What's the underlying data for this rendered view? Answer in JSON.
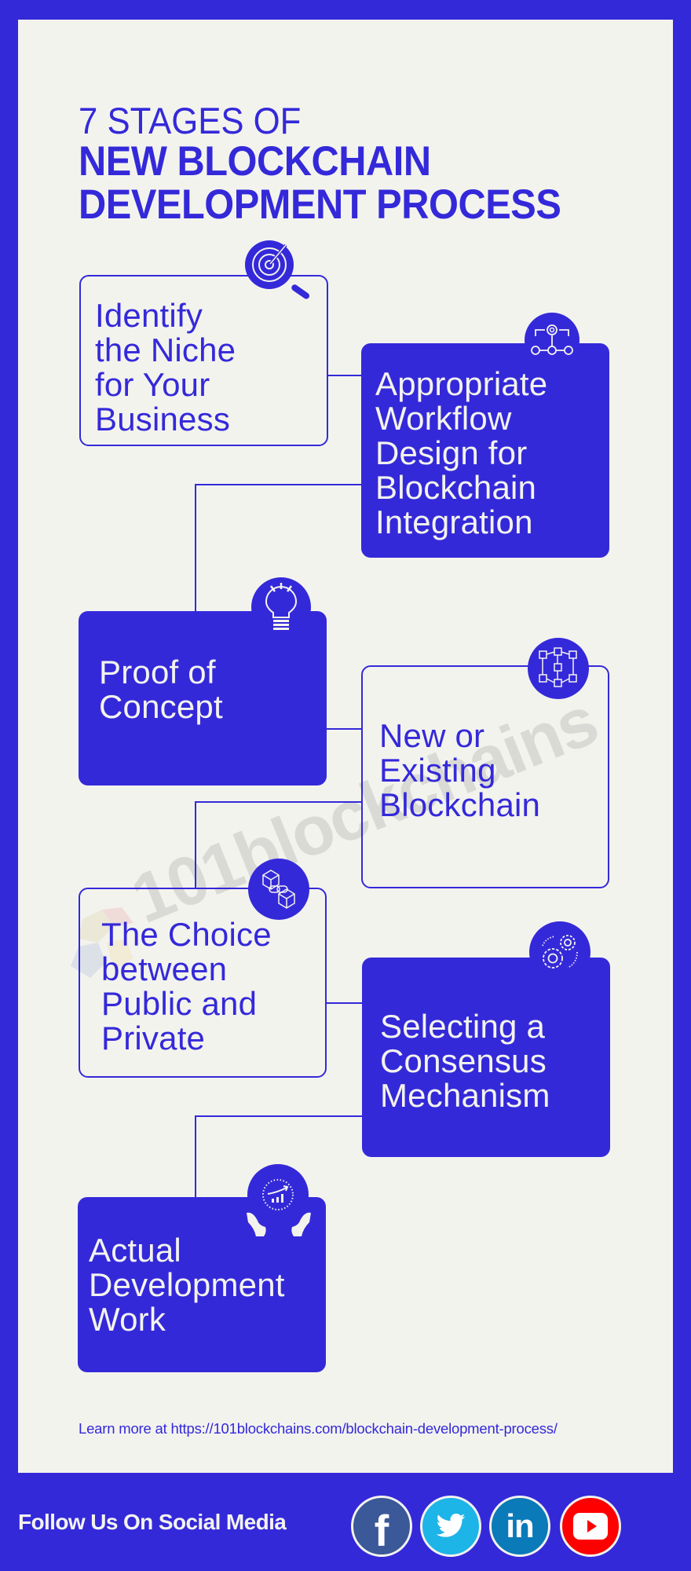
{
  "header": {
    "line1": "7 STAGES OF",
    "line2": "NEW BLOCKCHAIN",
    "line3": "DEVELOPMENT PROCESS"
  },
  "stages": [
    {
      "label": "Identify\nthe Niche\nfor Your\nBusiness",
      "icon": "target-search-icon",
      "style": "outline"
    },
    {
      "label": "Appropriate\nWorkflow\nDesign for\nBlockchain\nIntegration",
      "icon": "workflow-gear-icon",
      "style": "solid"
    },
    {
      "label": "Proof of\nConcept",
      "icon": "lightbulb-icon",
      "style": "solid"
    },
    {
      "label": "New or\nExisting\nBlockchain",
      "icon": "blockchain-network-icon",
      "style": "outline"
    },
    {
      "label": "The Choice\nbetween\nPublic and\nPrivate",
      "icon": "linked-blocks-icon",
      "style": "outline"
    },
    {
      "label": "Selecting a\nConsensus\nMechanism",
      "icon": "gears-cycle-icon",
      "style": "solid"
    },
    {
      "label": "Actual\nDevelopment\nWork",
      "icon": "growth-chart-hands-icon",
      "style": "solid"
    }
  ],
  "watermark": "101blockchains",
  "footer": {
    "learn_more": "Learn more at https://101blockchains.com/blockchain-development-process/",
    "follow": "Follow Us On Social Media",
    "social": [
      {
        "name": "facebook",
        "color": "#3b5998"
      },
      {
        "name": "twitter",
        "color": "#1da1f2"
      },
      {
        "name": "linkedin",
        "color": "#0a7ab8"
      },
      {
        "name": "youtube",
        "color": "#ff0000"
      }
    ]
  },
  "colors": {
    "brand_blue": "#3429d9",
    "panel_bg": "#f3f3ee"
  }
}
